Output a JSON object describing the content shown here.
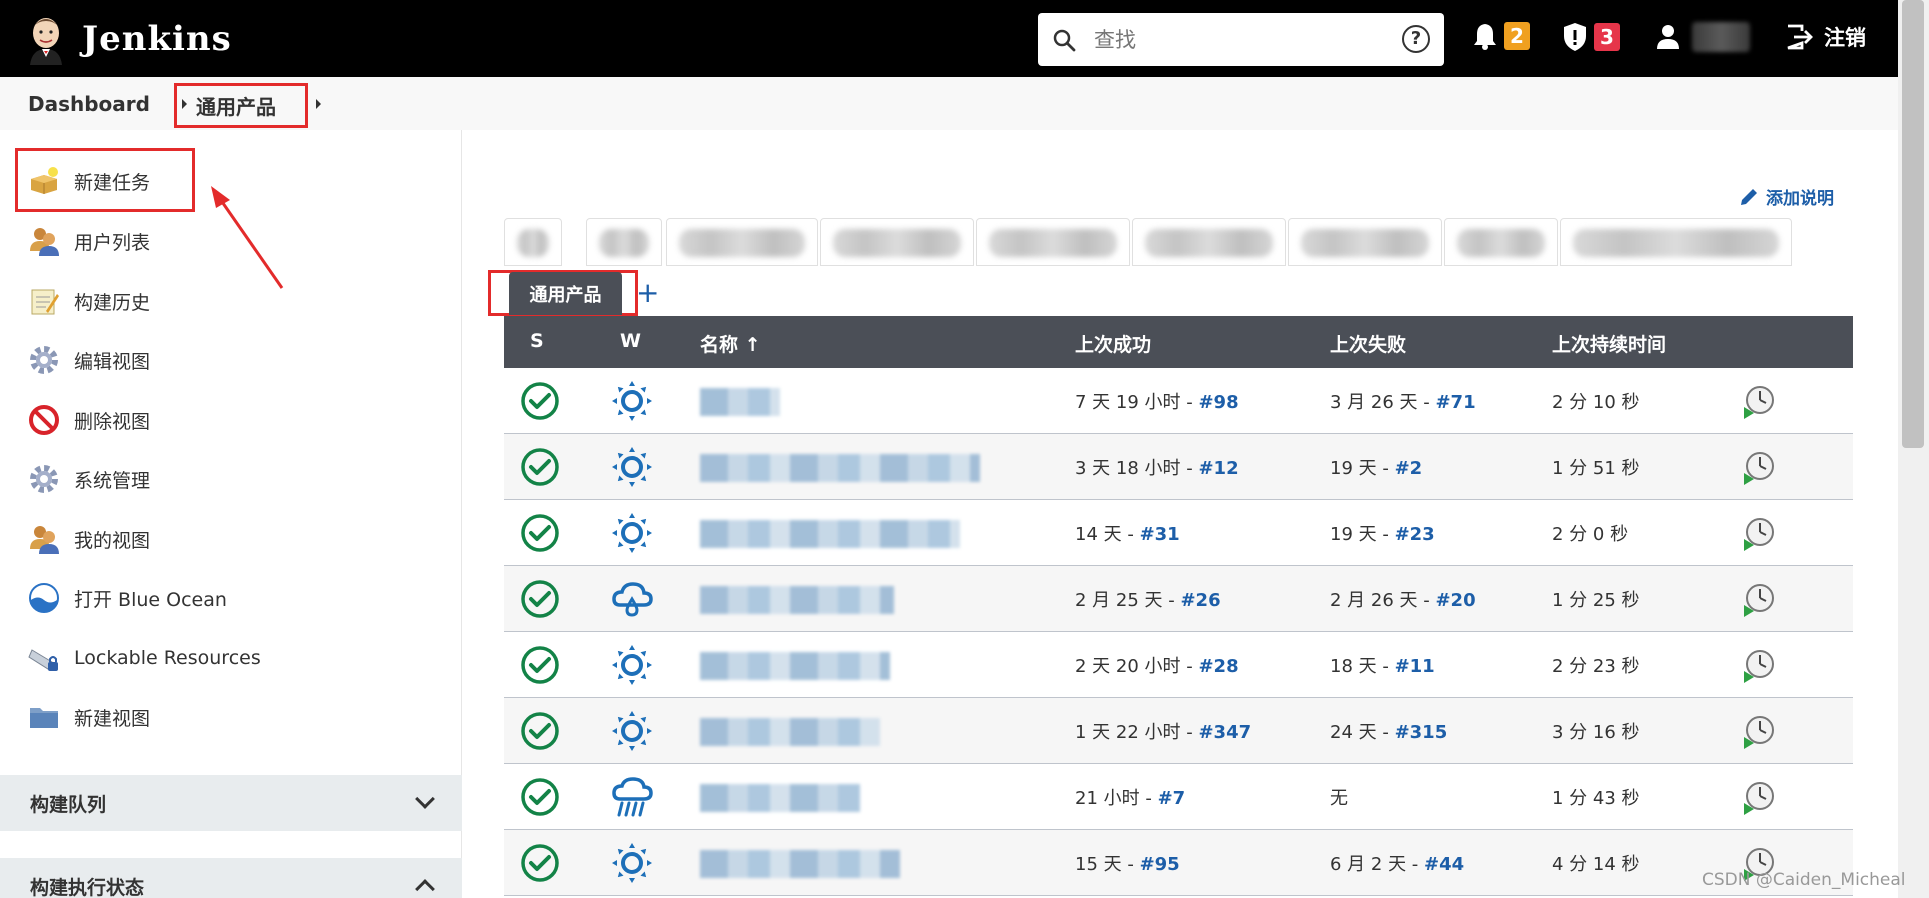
{
  "header": {
    "app_title": "Jenkins",
    "search_placeholder": "查找",
    "notifications_count": "2",
    "security_count": "3",
    "logout_label": "注销",
    "colors": {
      "bar": "#000000",
      "notif_badge": "#f0a020",
      "security_badge": "#e6354a"
    }
  },
  "breadcrumb": {
    "root": "Dashboard",
    "current": "通用产品"
  },
  "sidebar": {
    "items": [
      {
        "label": "新建任务",
        "icon": "new-item-icon"
      },
      {
        "label": "用户列表",
        "icon": "users-icon"
      },
      {
        "label": "构建历史",
        "icon": "notepad-icon"
      },
      {
        "label": "编辑视图",
        "icon": "gear-icon"
      },
      {
        "label": "删除视图",
        "icon": "no-entry-icon"
      },
      {
        "label": "系统管理",
        "icon": "gear-icon"
      },
      {
        "label": "我的视图",
        "icon": "users-icon"
      },
      {
        "label": "打开 Blue Ocean",
        "icon": "blue-ocean-icon"
      },
      {
        "label": "Lockable Resources",
        "icon": "lock-resource-icon"
      },
      {
        "label": "新建视图",
        "icon": "folder-icon"
      }
    ],
    "build_queue_title": "构建队列",
    "executor_status_title": "构建执行状态"
  },
  "main": {
    "add_description": "添加说明",
    "active_tab": "通用产品",
    "add_tab": "+",
    "columns": {
      "s": "S",
      "w": "W",
      "name": "名称 ↑",
      "last_success": "上次成功",
      "last_failure": "上次失败",
      "last_duration": "上次持续时间"
    },
    "rows": [
      {
        "weather": "sunny",
        "success_text": "7 天 19 小时 - ",
        "success_build": "#98",
        "failure_text": "3 月 26 天 - ",
        "failure_build": "#71",
        "duration": "2 分 10 秒"
      },
      {
        "weather": "sunny",
        "success_text": "3 天 18 小时 - ",
        "success_build": "#12",
        "failure_text": "19 天 - ",
        "failure_build": "#2",
        "duration": "1 分 51 秒"
      },
      {
        "weather": "sunny",
        "success_text": "14 天 - ",
        "success_build": "#31",
        "failure_text": "19 天 - ",
        "failure_build": "#23",
        "duration": "2 分 0 秒"
      },
      {
        "weather": "cloudy",
        "success_text": "2 月 25 天 - ",
        "success_build": "#26",
        "failure_text": "2 月 26 天 - ",
        "failure_build": "#20",
        "duration": "1 分 25 秒"
      },
      {
        "weather": "sunny",
        "success_text": "2 天 20 小时 - ",
        "success_build": "#28",
        "failure_text": "18 天 - ",
        "failure_build": "#11",
        "duration": "2 分 23 秒"
      },
      {
        "weather": "sunny",
        "success_text": "1 天 22 小时 - ",
        "success_build": "#347",
        "failure_text": "24 天 - ",
        "failure_build": "#315",
        "duration": "3 分 16 秒"
      },
      {
        "weather": "rainy",
        "success_text": "21 小时 - ",
        "success_build": "#7",
        "failure_text": "无",
        "failure_build": "",
        "duration": "1 分 43 秒"
      },
      {
        "weather": "sunny",
        "success_text": "15 天 - ",
        "success_build": "#95",
        "failure_text": "6 月 2 天 - ",
        "failure_build": "#44",
        "duration": "4 分 14 秒"
      }
    ]
  },
  "watermark": "CSDN @Caiden_Micheal"
}
